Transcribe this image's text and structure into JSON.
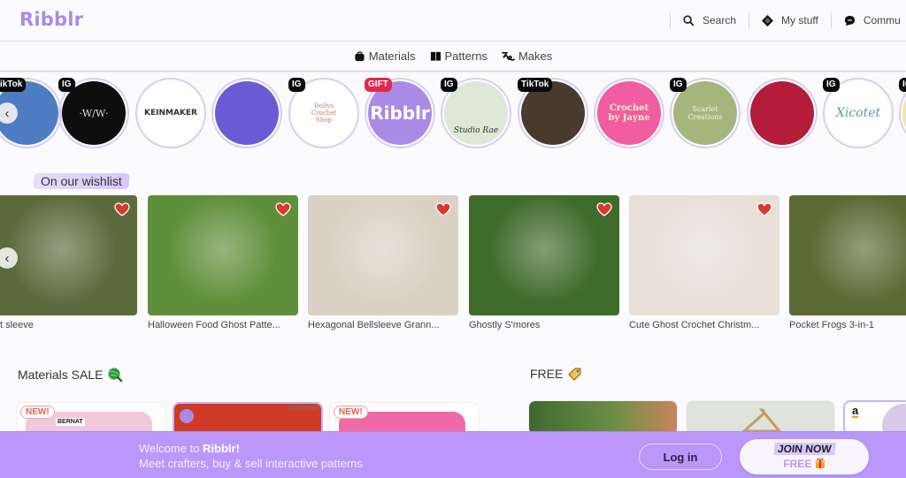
{
  "header": {
    "logo": "Ribblr",
    "nav": [
      {
        "label": "Search",
        "icon": "search-icon"
      },
      {
        "label": "My stuff",
        "icon": "diamond-icon"
      },
      {
        "label": "Commu",
        "icon": "chat-bubble-icon"
      }
    ]
  },
  "subnav": [
    {
      "label": "Materials",
      "icon": "bag-icon"
    },
    {
      "label": "Patterns",
      "icon": "book-icon"
    },
    {
      "label": "Makes",
      "icon": "yarn-squiggle-icon"
    }
  ],
  "stories": [
    {
      "badge": "TikTok",
      "text": "",
      "bg": "#4f7dc4"
    },
    {
      "badge": "IG",
      "text": "·W/W·",
      "bg": "#0e0e0e"
    },
    {
      "badge": "",
      "text": "KEINMAKER",
      "bg": "#ffffff"
    },
    {
      "badge": "",
      "text": "",
      "bg": "#6a5ad4"
    },
    {
      "badge": "IG",
      "text": "Dollys Crochet Shop",
      "bg": "#ffffff"
    },
    {
      "badge": "GIFT",
      "text": "Ribblr",
      "bg": "#a98be6"
    },
    {
      "badge": "IG",
      "text": "Studio Rae",
      "bg": "#dde8d6"
    },
    {
      "badge": "TikTok",
      "text": "",
      "bg": "#4a3a2e"
    },
    {
      "badge": "",
      "text": "Crochet by Jayne",
      "bg": "#f25ca0"
    },
    {
      "badge": "IG",
      "text": "Scarlet Creations",
      "bg": "#a5b67c"
    },
    {
      "badge": "",
      "text": "",
      "bg": "#b31d3a"
    },
    {
      "badge": "IG",
      "text": "Xicotet",
      "bg": "#ffffff"
    },
    {
      "badge": "IG",
      "text": "",
      "bg": "#f7e39a"
    }
  ],
  "wishlist": {
    "title": "On our wishlist",
    "items": [
      {
        "title": "Mesh Bat sleeve",
        "visible_title": "t sleeve",
        "bg": "#5c6b3c"
      },
      {
        "title": "Halloween Food Ghost Patte...",
        "bg": "#5f8f3a"
      },
      {
        "title": "Hexagonal Bellsleeve Grann...",
        "bg": "#d9d2c4"
      },
      {
        "title": "Ghostly S'mores",
        "bg": "#3f6b2b"
      },
      {
        "title": "Cute Ghost Crochet Christm...",
        "bg": "#e6e0d8"
      },
      {
        "title": "Pocket Frogs 3-in-1",
        "bg": "#5b6a34"
      }
    ]
  },
  "materials_sale": {
    "title": "Materials SALE",
    "items": [
      {
        "badge": "NEW!",
        "label": "BERNAT",
        "bg": "#f2c8dc"
      },
      {
        "badge": "",
        "label": "promoted",
        "bg": "#cf3b25"
      },
      {
        "badge": "NEW!",
        "label": "",
        "bg": "#f06aa8"
      }
    ]
  },
  "free": {
    "title": "FREE",
    "items": [
      {
        "bg": "#5b7a3e"
      },
      {
        "bg": "#dfe2dd"
      },
      {
        "bg": "#ffffff",
        "logo": "a"
      }
    ]
  },
  "banner": {
    "welcome_prefix": "Welcome to ",
    "welcome_brand": "Ribblr!",
    "tagline": "Meet crafters, buy & sell interactive patterns",
    "login": "Log in",
    "join_line1": "JOIN NOW",
    "join_line2": "FREE"
  }
}
